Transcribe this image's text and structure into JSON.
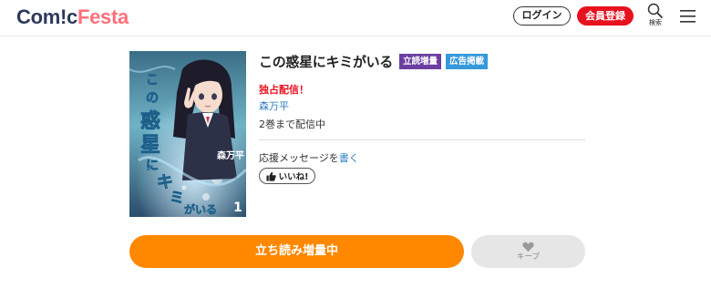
{
  "header": {
    "logo_part1": "Com!c",
    "logo_part2": "Festa",
    "login_label": "ログイン",
    "register_label": "会員登録",
    "search_label": "検索",
    "search_icon": "search-icon",
    "menu_icon": "hamburger-menu-icon"
  },
  "book": {
    "title": "この惑星にキミがいる",
    "badges": [
      "立読増量",
      "広告掲載"
    ],
    "exclusive": "独占配信！",
    "author": "森万平",
    "volumes": "2巻まで配信中",
    "cheer_prefix": "応援メッセージを",
    "cheer_link": "書く",
    "like_label": "いいね!",
    "cover_title": "この惑星にキミがいる",
    "cover_author": "森万平",
    "cover_volume": "1"
  },
  "actions": {
    "read_label": "立ち読み増量中",
    "keep_label": "キープ"
  },
  "colors": {
    "accent_orange": "#ff8800",
    "register_red": "#e8121f",
    "badge_purple": "#6b3fa0",
    "badge_blue": "#3599db",
    "link_blue": "#2f7ec1"
  }
}
